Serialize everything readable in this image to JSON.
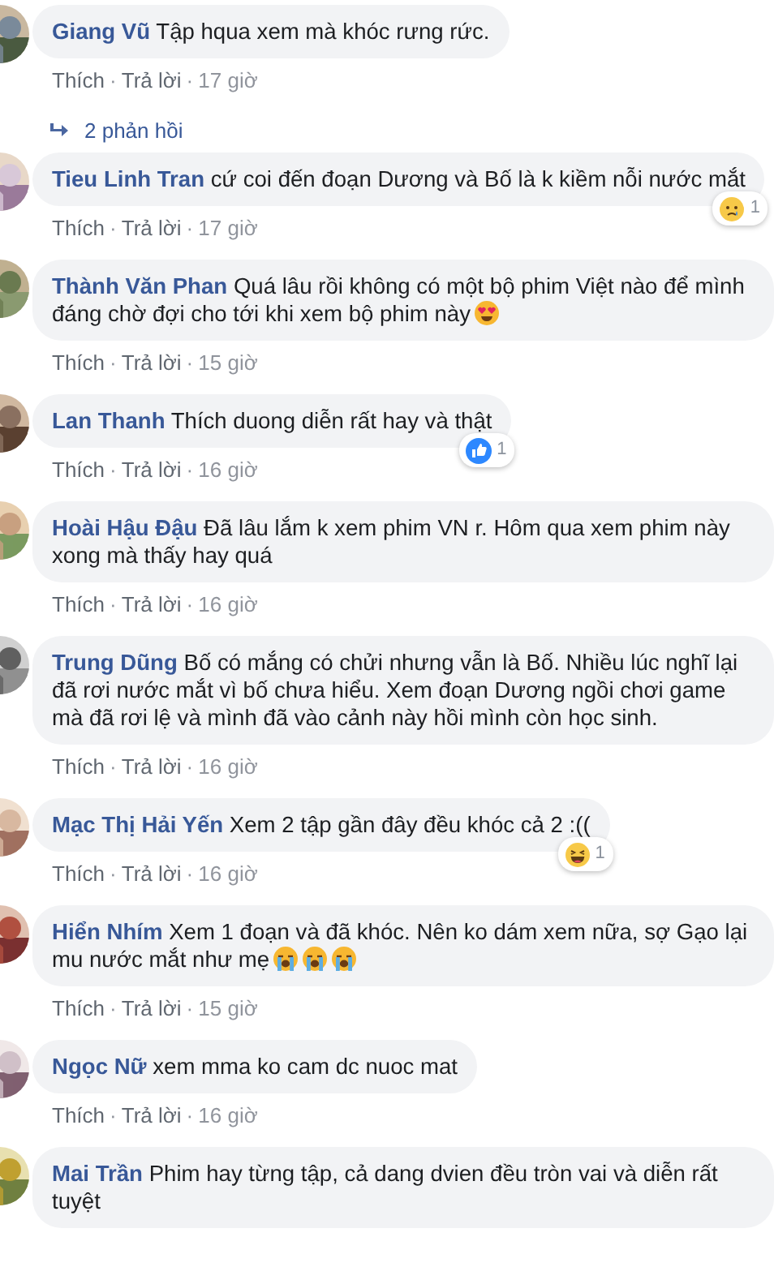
{
  "separator": "·",
  "comments": [
    {
      "author": "Giang Vũ",
      "text": "Tập hqua xem mà khóc rưng rức.",
      "like": "Thích",
      "reply": "Trả lời",
      "time": "17 giờ",
      "replies": "2 phản hồi"
    },
    {
      "author": "Tieu Linh Tran",
      "text": "cứ coi đến đoạn Dương và Bố là k kiềm nỗi nước mắt",
      "like": "Thích",
      "reply": "Trả lời",
      "time": "17 giờ",
      "reaction": {
        "kind": "sad",
        "count": "1"
      }
    },
    {
      "author": "Thành Văn Phan",
      "text": "Quá lâu rồi không có một bộ phim Việt nào để mình đáng chờ đợi cho tới khi xem bộ phim này",
      "emojis": [
        {
          "kind": "heart-eyes"
        }
      ],
      "like": "Thích",
      "reply": "Trả lời",
      "time": "15 giờ"
    },
    {
      "author": "Lan Thanh",
      "text": "Thích duong diễn rất hay và thật",
      "like": "Thích",
      "reply": "Trả lời",
      "time": "16 giờ",
      "reaction": {
        "kind": "like",
        "count": "1"
      }
    },
    {
      "author": "Hoài Hậu Đậu",
      "text": "Đã lâu lắm k xem phim VN r. Hôm qua xem phim này xong mà thấy hay quá",
      "like": "Thích",
      "reply": "Trả lời",
      "time": "16 giờ"
    },
    {
      "author": "Trung Dũng",
      "text": "Bố có mắng có chửi nhưng vẫn là Bố. Nhiều lúc nghĩ lại đã rơi nước mắt vì bố chưa hiểu. Xem đoạn Dương ngồi chơi game mà đã rơi lệ và mình đã vào cảnh này hồi mình còn học sinh.",
      "like": "Thích",
      "reply": "Trả lời",
      "time": "16 giờ"
    },
    {
      "author": "Mạc Thị Hải Yến",
      "text": "Xem 2 tập gần đây đều khóc cả 2 :((",
      "like": "Thích",
      "reply": "Trả lời",
      "time": "16 giờ",
      "reaction": {
        "kind": "haha",
        "count": "1"
      }
    },
    {
      "author": "Hiển Nhím",
      "text": "Xem 1 đoạn và đã khóc. Nên ko dám xem nữa, sợ Gạo lại mu nước mắt như mẹ",
      "emojis": [
        {
          "kind": "crying"
        },
        {
          "kind": "crying"
        },
        {
          "kind": "crying"
        }
      ],
      "like": "Thích",
      "reply": "Trả lời",
      "time": "15 giờ"
    },
    {
      "author": "Ngọc Nữ",
      "text": "xem mma ko cam dc nuoc mat",
      "like": "Thích",
      "reply": "Trả lời",
      "time": "16 giờ"
    },
    {
      "author": "Mai Trần",
      "text": "Phim hay từng tập, cả dang dvien đều tròn vai và diễn rất tuyệt"
    }
  ]
}
